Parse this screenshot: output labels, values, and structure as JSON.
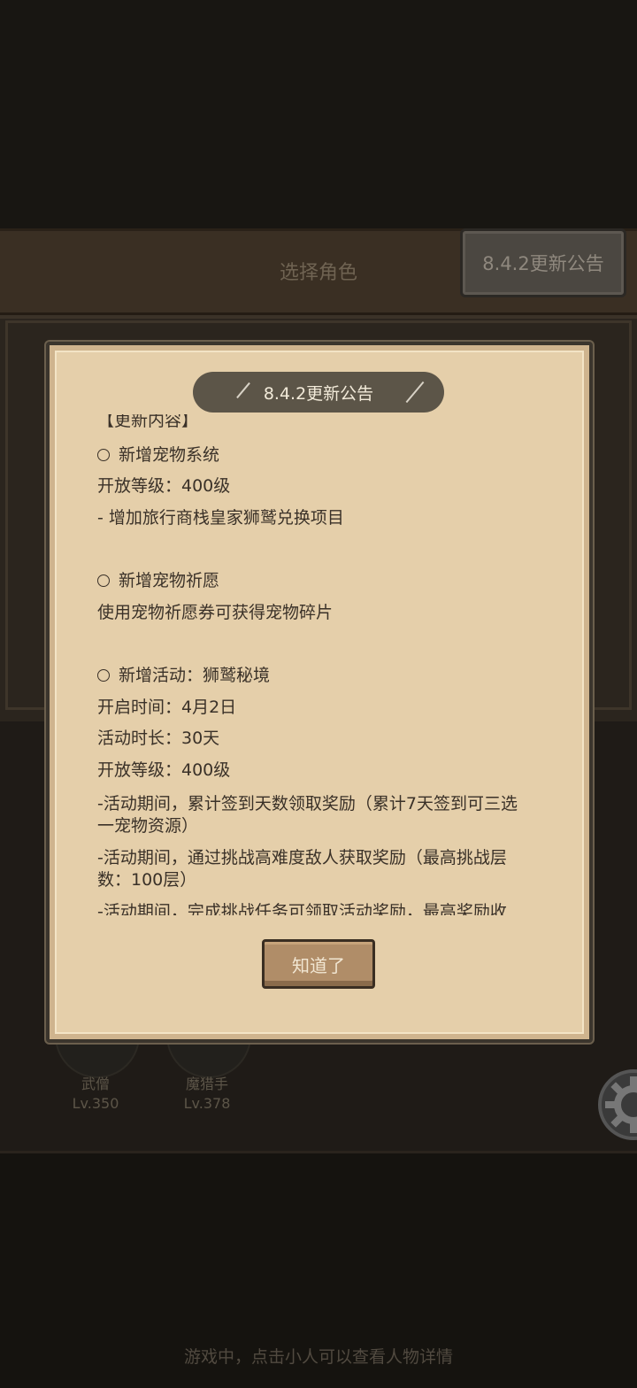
{
  "background": {
    "header_title": "选择角色",
    "notice_button": "8.4.2更新公告",
    "characters": [
      {
        "name": "武僧",
        "level": "Lv.350"
      },
      {
        "name": "魔猎手",
        "level": "Lv.378"
      }
    ],
    "bottom_hint": "游戏中，点击小人可以查看人物详情"
  },
  "dialog": {
    "title": "8.4.2更新公告",
    "content_lines": [
      "【更新内容】",
      "新增宠物系统",
      "开放等级：400级",
      "- 增加旅行商栈皇家狮鹫兑换项目",
      "新增宠物祈愿",
      "使用宠物祈愿券可获得宠物碎片",
      "新增活动：狮鹫秘境",
      "开启时间：4月2日",
      "活动时长：30天",
      "开放等级：400级",
      "-活动期间，累计签到天数领取奖励（累计7天签到可三选",
      "一宠物资源）",
      "-活动期间，通过挑战高难度敌人获取奖励（最高挑战层",
      "数：100层）",
      "-活动期间，完成挑战任务可领取活动奖励，最高奖励收"
    ],
    "ok_button": "知道了"
  },
  "colors": {
    "parchment": "#e5cfaa",
    "title_pill": "#5c5548",
    "text": "#3a3128"
  }
}
